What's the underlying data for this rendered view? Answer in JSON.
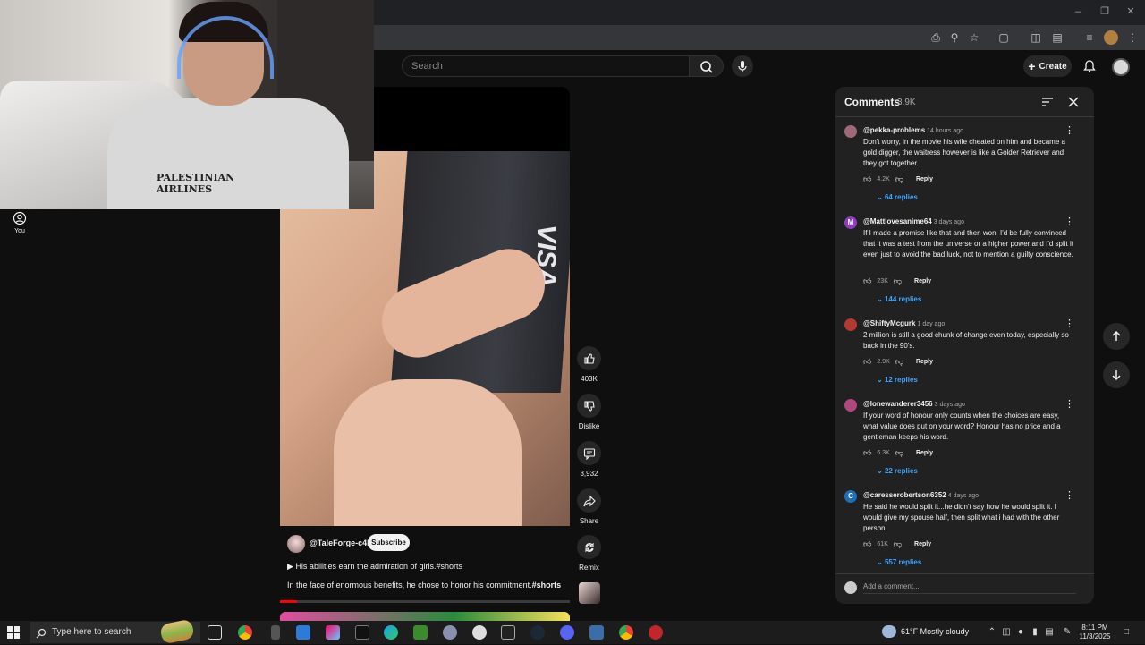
{
  "header": {
    "search_placeholder": "Search",
    "create_label": "Create"
  },
  "sidebar": {
    "you_label": "You"
  },
  "short": {
    "channel": "@TaleForge-c4k",
    "subscribe_label": "Subscribe",
    "title": "His abilities earn the admiration of girls.#shorts",
    "description": "In the face of enormous benefits, he chose to honor his commitment.",
    "description_tag": "#shorts",
    "card_text": "VISA",
    "progress_fraction": 0.06
  },
  "webcam": {
    "shirt_text": "PALESTINIAN AIRLINES"
  },
  "actions": {
    "likes": "403K",
    "dislike": "Dislike",
    "comments": "3,932",
    "share": "Share",
    "remix": "Remix"
  },
  "comments_panel": {
    "title": "Comments",
    "count": "3.9K",
    "add_placeholder": "Add a comment...",
    "reply_label": "Reply",
    "items": [
      {
        "author": "@pekka-problems",
        "time": "14 hours ago",
        "text": "Don't worry, in the movie his wife cheated on him and became a gold digger, the waitress however is like a Golder Retriever and they got together.",
        "likes": "4.2K",
        "replies": "64 replies",
        "avatar_color": "#a0697a",
        "avatar_letter": ""
      },
      {
        "author": "@Mattlovesanime64",
        "time": "3 days ago",
        "text": "If I made a promise like that and then won, I'd be fully convinced that it was a test from the universe or a higher power and I'd split it even just to avoid the bad luck, not to mention a guilty conscience.",
        "likes": "23K",
        "replies": "144 replies",
        "avatar_color": "#8e3dbf",
        "avatar_letter": "M"
      },
      {
        "author": "@ShiftyMcgurk",
        "time": "1 day ago",
        "text": "2 million is still a good chunk of change even today, especially so back in the 90's.",
        "likes": "2.9K",
        "replies": "12 replies",
        "avatar_color": "#b33a2f",
        "avatar_letter": ""
      },
      {
        "author": "@lonewanderer3456",
        "time": "3 days ago",
        "text": "If your word of honour only counts when the choices are easy, what value does put on your word? Honour has no price and a gentleman keeps his word.",
        "likes": "6.3K",
        "replies": "22 replies",
        "avatar_color": "#b0487e",
        "avatar_letter": ""
      },
      {
        "author": "@caresserobertson6352",
        "time": "4 days ago",
        "text": "He said he would split it...he didn't say how he would split it. I would give my spouse half, then split what i had with the other person.",
        "likes": "61K",
        "replies": "557 replies",
        "avatar_color": "#1f6fb5",
        "avatar_letter": "C"
      }
    ]
  },
  "taskbar": {
    "search_placeholder": "Type here to search",
    "weather": "61°F  Mostly cloudy",
    "time": "8:11 PM",
    "date": "11/3/2025"
  },
  "colors": {
    "background": "#0f0f0f",
    "panel": "#212121",
    "link_blue": "#3ea6ff",
    "progress_red": "#ff0000"
  }
}
